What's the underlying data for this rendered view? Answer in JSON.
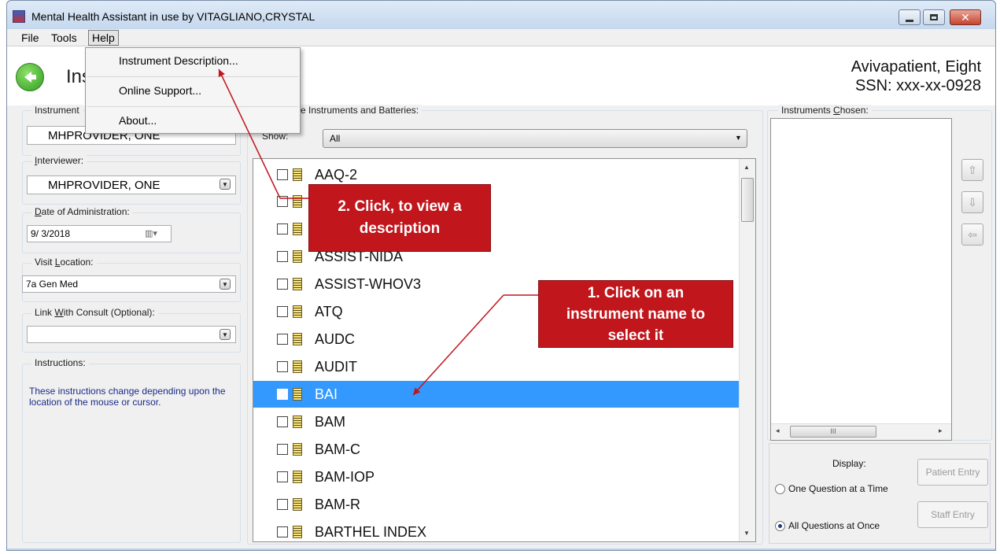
{
  "window": {
    "title": "Mental Health Assistant in use by VITAGLIANO,CRYSTAL"
  },
  "menubar": {
    "items": [
      "File",
      "Tools",
      "Help"
    ]
  },
  "help_menu": {
    "items": [
      "Instrument Description...",
      "Online Support...",
      "About..."
    ]
  },
  "header": {
    "page_title_visible": "Ins",
    "patient_name": "Avivapatient, Eight",
    "patient_ssn": "SSN: xxx-xx-0928"
  },
  "left_panel": {
    "instrument_label_visible": "Instrument",
    "instrument_value": "MHPROVIDER, ONE",
    "interviewer_label": "Interviewer:",
    "interviewer_value": "MHPROVIDER, ONE",
    "date_label": "Date of Administration:",
    "date_value": "9/ 3/2018",
    "visit_location_label": "Visit Location:",
    "visit_location_value": "7a Gen Med",
    "consult_label": "Link With Consult (Optional):",
    "consult_value": "",
    "instructions_label": "Instructions:",
    "instructions_text": "These instructions change depending upon the location of the mouse or cursor."
  },
  "center_panel": {
    "available_label_visible": "e Instruments and Batteries:",
    "show_label": "Show:",
    "show_value": "All",
    "instruments": [
      {
        "name": "AAQ-2",
        "checked": false,
        "selected": false
      },
      {
        "name": "",
        "checked": false,
        "selected": false
      },
      {
        "name": "",
        "checked": false,
        "selected": false
      },
      {
        "name": "ASSIST-NIDA",
        "checked": false,
        "selected": false
      },
      {
        "name": "ASSIST-WHOV3",
        "checked": false,
        "selected": false
      },
      {
        "name": "ATQ",
        "checked": false,
        "selected": false
      },
      {
        "name": "AUDC",
        "checked": false,
        "selected": false
      },
      {
        "name": "AUDIT",
        "checked": false,
        "selected": false
      },
      {
        "name": "BAI",
        "checked": false,
        "selected": true
      },
      {
        "name": "BAM",
        "checked": false,
        "selected": false
      },
      {
        "name": "BAM-C",
        "checked": false,
        "selected": false
      },
      {
        "name": "BAM-IOP",
        "checked": false,
        "selected": false
      },
      {
        "name": "BAM-R",
        "checked": false,
        "selected": false
      },
      {
        "name": "BARTHEL INDEX",
        "checked": false,
        "selected": false
      }
    ]
  },
  "right_panel": {
    "chosen_label": "Instruments Chosen:",
    "hscroll_grip": "III",
    "display_label": "Display:",
    "option_one_question": "One Question at a Time",
    "option_all_questions": "All Questions at Once",
    "display_selected": "All Questions at Once",
    "patient_entry_label": "Patient Entry",
    "staff_entry_label": "Staff Entry"
  },
  "callouts": {
    "step1": [
      "1. Click on an",
      "instrument name to",
      "select it"
    ],
    "step2": [
      "2. Click, to view a",
      "description"
    ]
  },
  "colors": {
    "selection": "#3399ff",
    "callout": "#c0161c",
    "arrow": "#c0161c",
    "instructions_text": "#1a2a88"
  },
  "icons": {
    "back": "back-arrow-icon",
    "instrument": "document-icon"
  }
}
